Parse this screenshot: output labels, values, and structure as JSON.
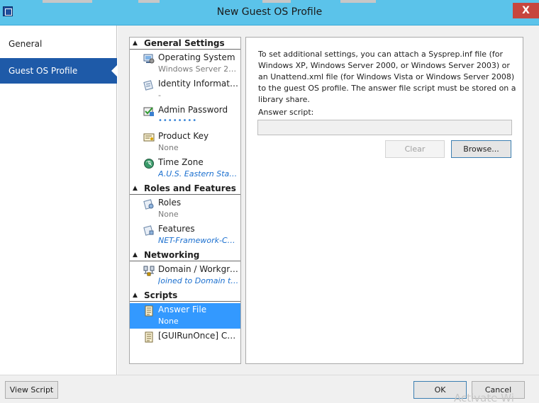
{
  "window": {
    "title": "New Guest OS Profile",
    "close_label": "X"
  },
  "nav": {
    "items": [
      {
        "label": "General",
        "active": false
      },
      {
        "label": "Guest OS Profile",
        "active": true
      }
    ]
  },
  "settings": {
    "sections": [
      {
        "title": "General Settings",
        "items": [
          {
            "label": "Operating System",
            "value": "Windows Server 201...",
            "icon": "operating-system-icon"
          },
          {
            "label": "Identity Information",
            "value": "-",
            "icon": "identity-icon"
          },
          {
            "label": "Admin Password",
            "value": "••••••••",
            "icon": "admin-password-icon"
          },
          {
            "label": "Product Key",
            "value": "None",
            "icon": "product-key-icon"
          },
          {
            "label": "Time Zone",
            "value": "A.U.S. Eastern Stan...",
            "icon": "time-zone-icon"
          }
        ]
      },
      {
        "title": "Roles and Features",
        "items": [
          {
            "label": "Roles",
            "value": "None",
            "icon": "roles-icon"
          },
          {
            "label": "Features",
            "value": "NET-Framework-Core",
            "icon": "features-icon"
          }
        ]
      },
      {
        "title": "Networking",
        "items": [
          {
            "label": "Domain / Workgro...",
            "value": "Joined to Domain tim...",
            "icon": "domain-icon"
          }
        ]
      },
      {
        "title": "Scripts",
        "items": [
          {
            "label": "Answer File",
            "value": "None",
            "icon": "answer-file-icon",
            "selected": true
          },
          {
            "label": "[GUIRunOnce] Co...",
            "value": "",
            "icon": "gui-run-once-icon"
          }
        ]
      }
    ]
  },
  "details": {
    "description": "To set additional settings, you can attach a Sysprep.inf file (for Windows XP, Windows Server 2000, or Windows Server 2003) or an Unattend.xml file (for Windows Vista or Windows Server 2008) to the guest OS profile. The answer file script must be stored on a library share.",
    "answer_label": "Answer script:",
    "answer_value": "",
    "clear_label": "Clear",
    "browse_label": "Browse..."
  },
  "footer": {
    "view_script_label": "View Script",
    "ok_label": "OK",
    "cancel_label": "Cancel",
    "watermark": "Activate Wi"
  },
  "colors": {
    "titlebar": "#5bc3ea",
    "close": "#c7463e",
    "nav_active": "#1e5aa8",
    "selection": "#3399ff",
    "link": "#1a6fcf"
  }
}
